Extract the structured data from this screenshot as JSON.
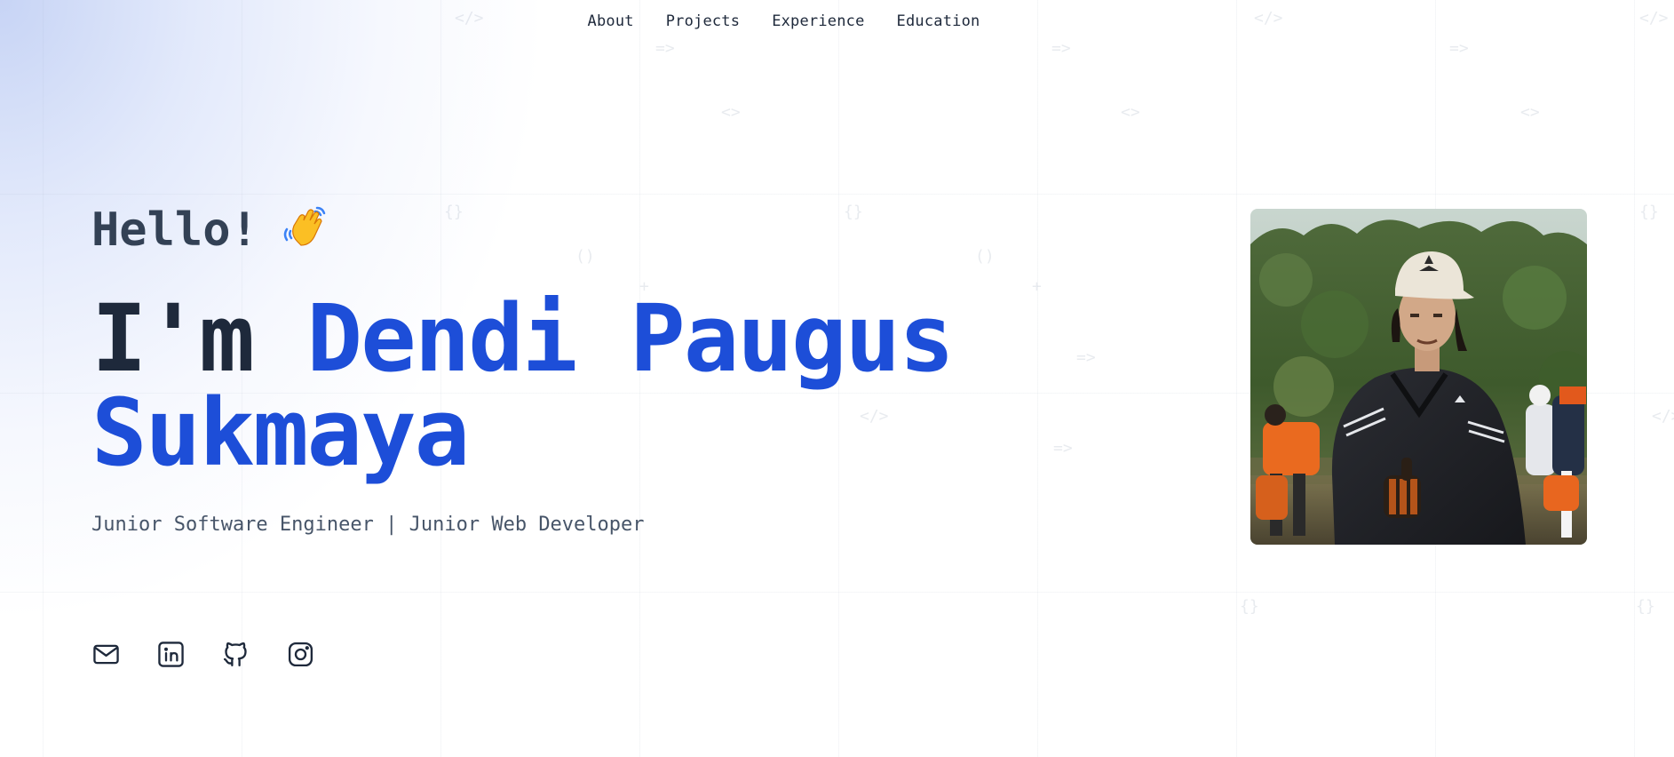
{
  "nav": {
    "items": [
      {
        "label": "About"
      },
      {
        "label": "Projects"
      },
      {
        "label": "Experience"
      },
      {
        "label": "Education"
      }
    ]
  },
  "hero": {
    "greeting": "Hello!",
    "greeting_icon": "waving-hand-icon",
    "name_prefix": "I'm",
    "name_first": "Dendi Paugus",
    "name_last": "Sukmaya",
    "role": "Junior Software Engineer | Junior Web Developer"
  },
  "socials": [
    {
      "icon": "mail-icon"
    },
    {
      "icon": "linkedin-icon"
    },
    {
      "icon": "github-icon"
    },
    {
      "icon": "instagram-icon"
    }
  ],
  "colors": {
    "accent": "#1d4ed8",
    "text_dark": "#1e293b",
    "text_muted": "#475569",
    "gradient_start": "#c7d4f5"
  }
}
